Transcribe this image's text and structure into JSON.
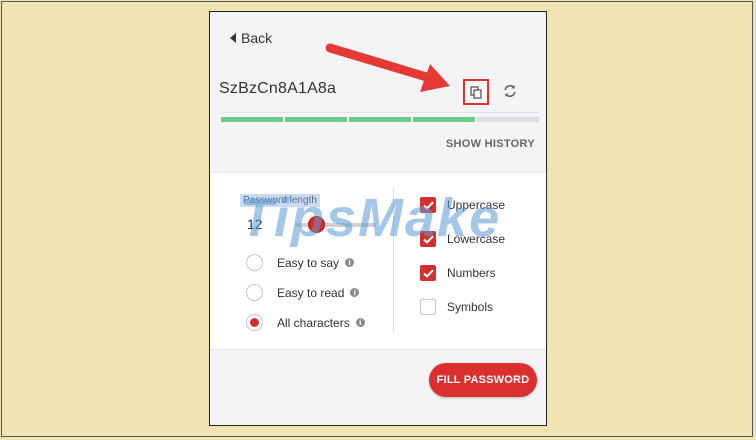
{
  "header": {
    "back_label": "Back"
  },
  "generator": {
    "password": "SzBzCn8A1A8a",
    "copy_icon": "copy-icon",
    "refresh_icon": "refresh-icon",
    "strength": {
      "filled_segments": 4,
      "total_segments": 5,
      "color": "#6ecb87"
    },
    "show_history_label": "SHOW HISTORY"
  },
  "options": {
    "length_label": "Password length",
    "length_value": "12",
    "modes": [
      {
        "label": "Easy to say",
        "selected": false
      },
      {
        "label": "Easy to read",
        "selected": false
      },
      {
        "label": "All characters",
        "selected": true
      }
    ],
    "charsets": [
      {
        "label": "Uppercase",
        "checked": true
      },
      {
        "label": "Lowercase",
        "checked": true
      },
      {
        "label": "Numbers",
        "checked": true
      },
      {
        "label": "Symbols",
        "checked": false
      }
    ]
  },
  "fill_button_label": "FILL PASSWORD",
  "watermark_text": "TipsMake",
  "colors": {
    "accent": "#dc3030",
    "background": "#f0e3b2",
    "strength": "#6ecb87"
  }
}
